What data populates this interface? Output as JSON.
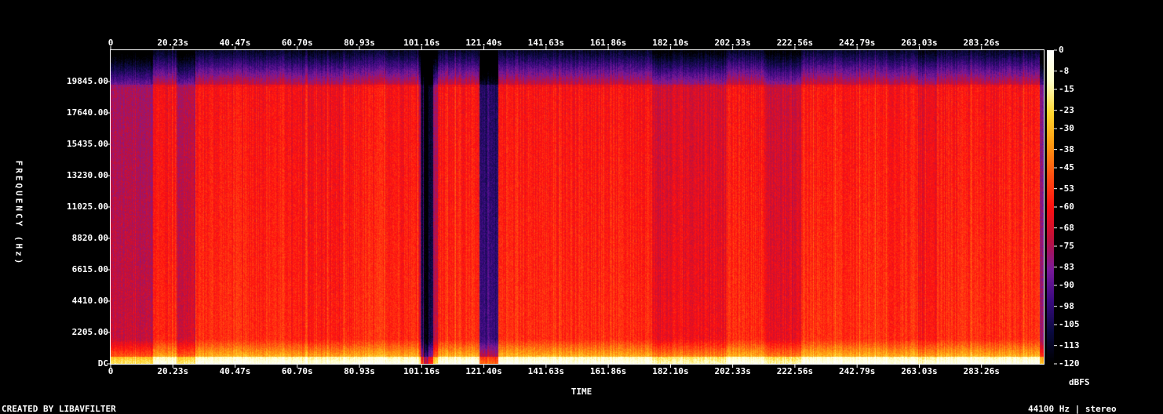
{
  "chart_data": {
    "type": "heatmap",
    "x_ticks": [
      "0",
      "20.23s",
      "40.47s",
      "60.70s",
      "80.93s",
      "101.16s",
      "121.40s",
      "141.63s",
      "161.86s",
      "182.10s",
      "202.33s",
      "222.56s",
      "242.79s",
      "263.03s",
      "283.26s"
    ],
    "y_ticks": [
      "DC",
      "2205.00",
      "4410.00",
      "6615.00",
      "8820.00",
      "11025.00",
      "13230.00",
      "15435.00",
      "17640.00",
      "19845.00"
    ],
    "y_tick_values": [
      0,
      2205,
      4410,
      6615,
      8820,
      11025,
      13230,
      15435,
      17640,
      19845
    ],
    "ylim": [
      0,
      22050
    ],
    "x_tick_values": [
      0,
      20.23,
      40.47,
      60.7,
      80.93,
      101.16,
      121.4,
      141.63,
      161.86,
      182.1,
      202.33,
      222.56,
      242.79,
      263.03,
      283.26
    ],
    "xlim": [
      0,
      303.5
    ],
    "xlabel": "TIME",
    "ylabel": "FREQUENCY (Hz)",
    "colorbar_ticks": [
      "0",
      "-8",
      "-15",
      "-23",
      "-30",
      "-38",
      "-45",
      "-53",
      "-60",
      "-68",
      "-75",
      "-83",
      "-90",
      "-98",
      "-105",
      "-113",
      "-120"
    ],
    "colorbar_range": [
      -120,
      0
    ],
    "colorbar_label": "dBFS",
    "colormap": [
      "#000000",
      "#0a0a40",
      "#3a0a80",
      "#7a1a9a",
      "#c0103a",
      "#ff1010",
      "#ff5010",
      "#ff9a10",
      "#ffd830",
      "#ffffc8",
      "#ffffff"
    ],
    "footer_left": "CREATED BY LIBAVFILTER",
    "footer_right": "44100 Hz | stereo"
  }
}
